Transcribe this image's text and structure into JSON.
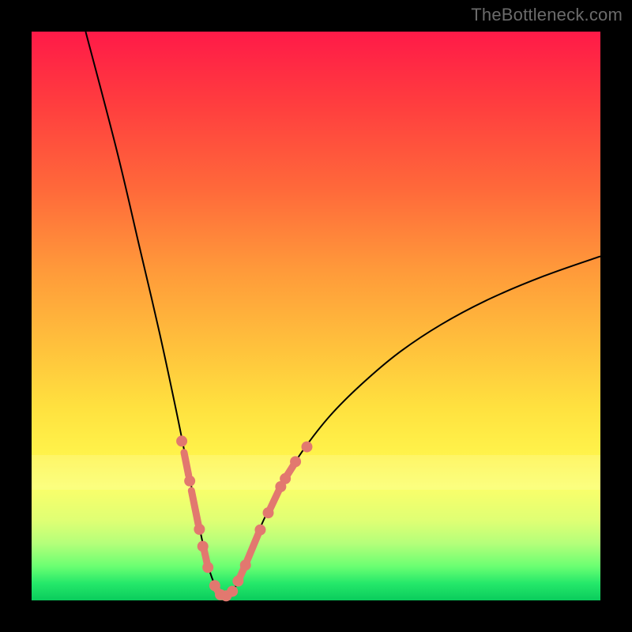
{
  "watermark": "TheBottleneck.com",
  "colors": {
    "frame": "#000000",
    "gradient_top": "#ff1a48",
    "gradient_bottom": "#0acc5c",
    "curve": "#000000",
    "marker": "#e2786f"
  },
  "chart_data": {
    "type": "line",
    "title": "",
    "xlabel": "",
    "ylabel": "",
    "xlim": [
      0,
      100
    ],
    "ylim": [
      0,
      100
    ],
    "grid": false,
    "legend": false,
    "comment": "Axes are not labeled in the source image; x and y values below are estimated from pixel positions on a 0–100 normalized scale (0 at left/bottom, 100 at right/top). The curve is a single smooth V-shaped line with minimum near x≈33. Salmon markers/segments are overlaid on the curve near the bottom.",
    "series": [
      {
        "name": "main-curve",
        "color": "#000000",
        "points": [
          {
            "x": 9.5,
            "y": 100.0
          },
          {
            "x": 15.0,
            "y": 79.0
          },
          {
            "x": 19.0,
            "y": 62.0
          },
          {
            "x": 22.5,
            "y": 47.0
          },
          {
            "x": 25.5,
            "y": 33.0
          },
          {
            "x": 27.3,
            "y": 24.0
          },
          {
            "x": 28.7,
            "y": 17.0
          },
          {
            "x": 30.0,
            "y": 10.5
          },
          {
            "x": 31.2,
            "y": 5.5
          },
          {
            "x": 32.6,
            "y": 2.0
          },
          {
            "x": 34.0,
            "y": 0.7
          },
          {
            "x": 35.6,
            "y": 2.0
          },
          {
            "x": 37.2,
            "y": 5.5
          },
          {
            "x": 39.0,
            "y": 10.0
          },
          {
            "x": 41.2,
            "y": 15.0
          },
          {
            "x": 44.0,
            "y": 20.5
          },
          {
            "x": 47.8,
            "y": 26.5
          },
          {
            "x": 52.5,
            "y": 32.5
          },
          {
            "x": 58.0,
            "y": 38.0
          },
          {
            "x": 64.5,
            "y": 43.5
          },
          {
            "x": 72.0,
            "y": 48.5
          },
          {
            "x": 80.5,
            "y": 53.0
          },
          {
            "x": 90.0,
            "y": 57.0
          },
          {
            "x": 100.0,
            "y": 60.5
          }
        ]
      }
    ],
    "markers": {
      "comment": "Salmon-colored circular markers and short thick segments overlaid on the curve in the lower region (roughly y < 27%).",
      "color": "#e2786f",
      "dot_radius_px": 7,
      "dots": [
        {
          "x": 26.4,
          "y": 28.0
        },
        {
          "x": 27.8,
          "y": 21.0
        },
        {
          "x": 29.5,
          "y": 12.5
        },
        {
          "x": 30.1,
          "y": 9.5
        },
        {
          "x": 31.0,
          "y": 5.8
        },
        {
          "x": 32.2,
          "y": 2.6
        },
        {
          "x": 33.2,
          "y": 1.0
        },
        {
          "x": 34.2,
          "y": 0.8
        },
        {
          "x": 35.3,
          "y": 1.6
        },
        {
          "x": 36.3,
          "y": 3.4
        },
        {
          "x": 37.6,
          "y": 6.2
        },
        {
          "x": 40.2,
          "y": 12.4
        },
        {
          "x": 41.6,
          "y": 15.4
        },
        {
          "x": 43.8,
          "y": 20.0
        },
        {
          "x": 44.6,
          "y": 21.4
        },
        {
          "x": 46.4,
          "y": 24.4
        },
        {
          "x": 48.4,
          "y": 27.0
        }
      ],
      "segments": [
        {
          "x1": 26.8,
          "y1": 26.0,
          "x2": 27.6,
          "y2": 22.0
        },
        {
          "x1": 28.1,
          "y1": 19.3,
          "x2": 29.3,
          "y2": 13.4
        },
        {
          "x1": 30.3,
          "y1": 9.0,
          "x2": 30.9,
          "y2": 6.3
        },
        {
          "x1": 32.4,
          "y1": 2.2,
          "x2": 33.0,
          "y2": 1.2
        },
        {
          "x1": 34.4,
          "y1": 0.8,
          "x2": 35.1,
          "y2": 1.3
        },
        {
          "x1": 36.5,
          "y1": 3.8,
          "x2": 37.4,
          "y2": 5.8
        },
        {
          "x1": 37.9,
          "y1": 7.0,
          "x2": 39.9,
          "y2": 11.8
        },
        {
          "x1": 41.8,
          "y1": 15.8,
          "x2": 43.5,
          "y2": 19.4
        },
        {
          "x1": 44.8,
          "y1": 21.8,
          "x2": 46.2,
          "y2": 24.0
        }
      ]
    },
    "pale_band": {
      "y_from": 19.5,
      "y_to": 25.5
    }
  }
}
